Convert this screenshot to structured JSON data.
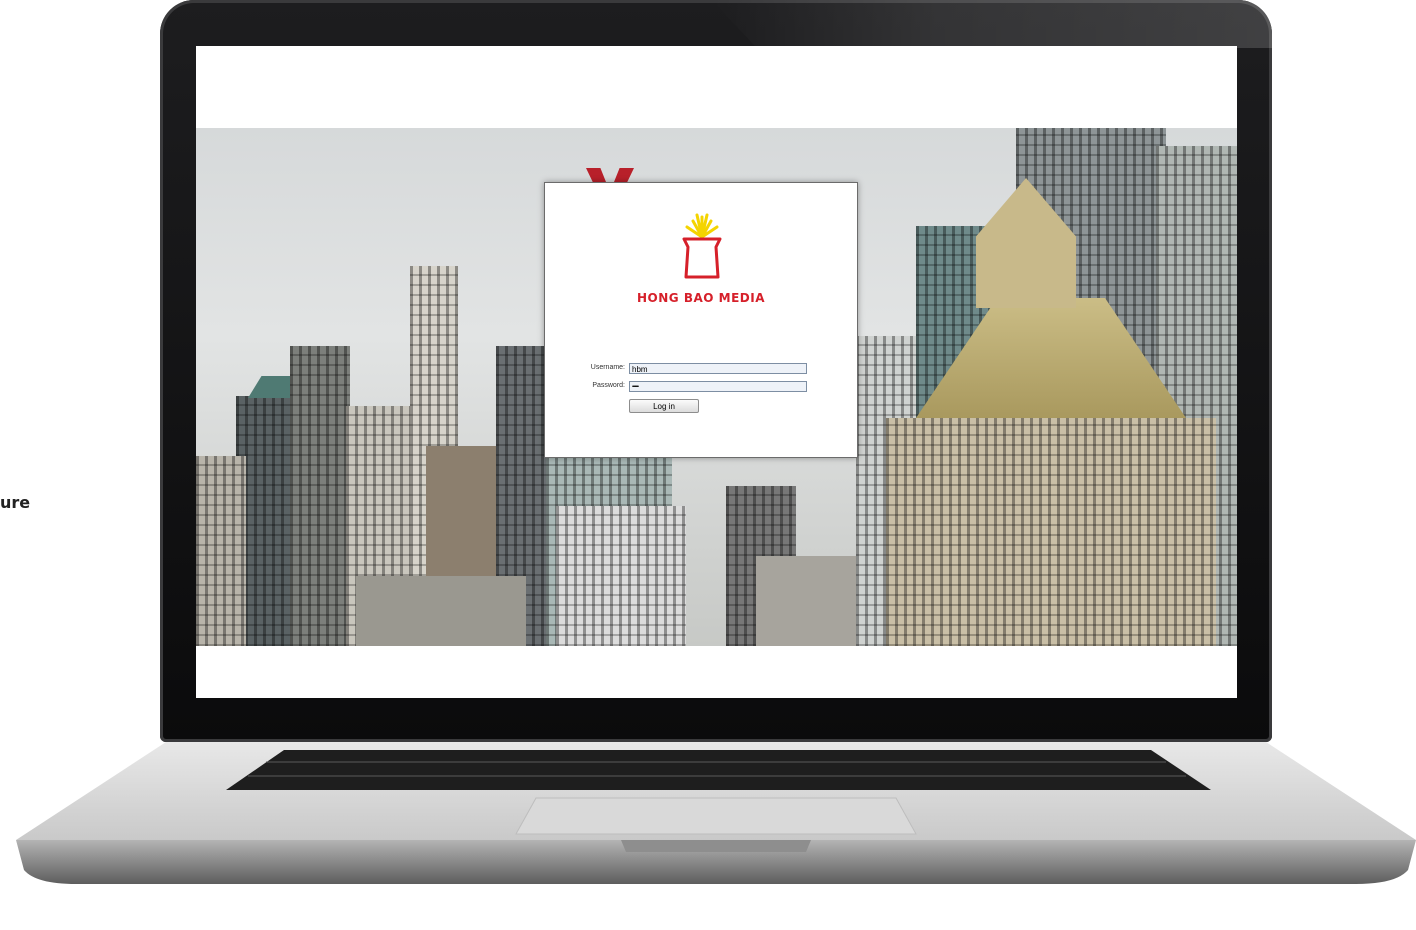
{
  "side_text": "ure",
  "brand": {
    "name": "HONG BAO MEDIA",
    "color_red": "#d6202a",
    "color_yellow": "#f4d400"
  },
  "login": {
    "username_label": "Username:",
    "username_value": "hbm",
    "password_label": "Password:",
    "password_value": "••••••••",
    "login_button": "Log in"
  }
}
